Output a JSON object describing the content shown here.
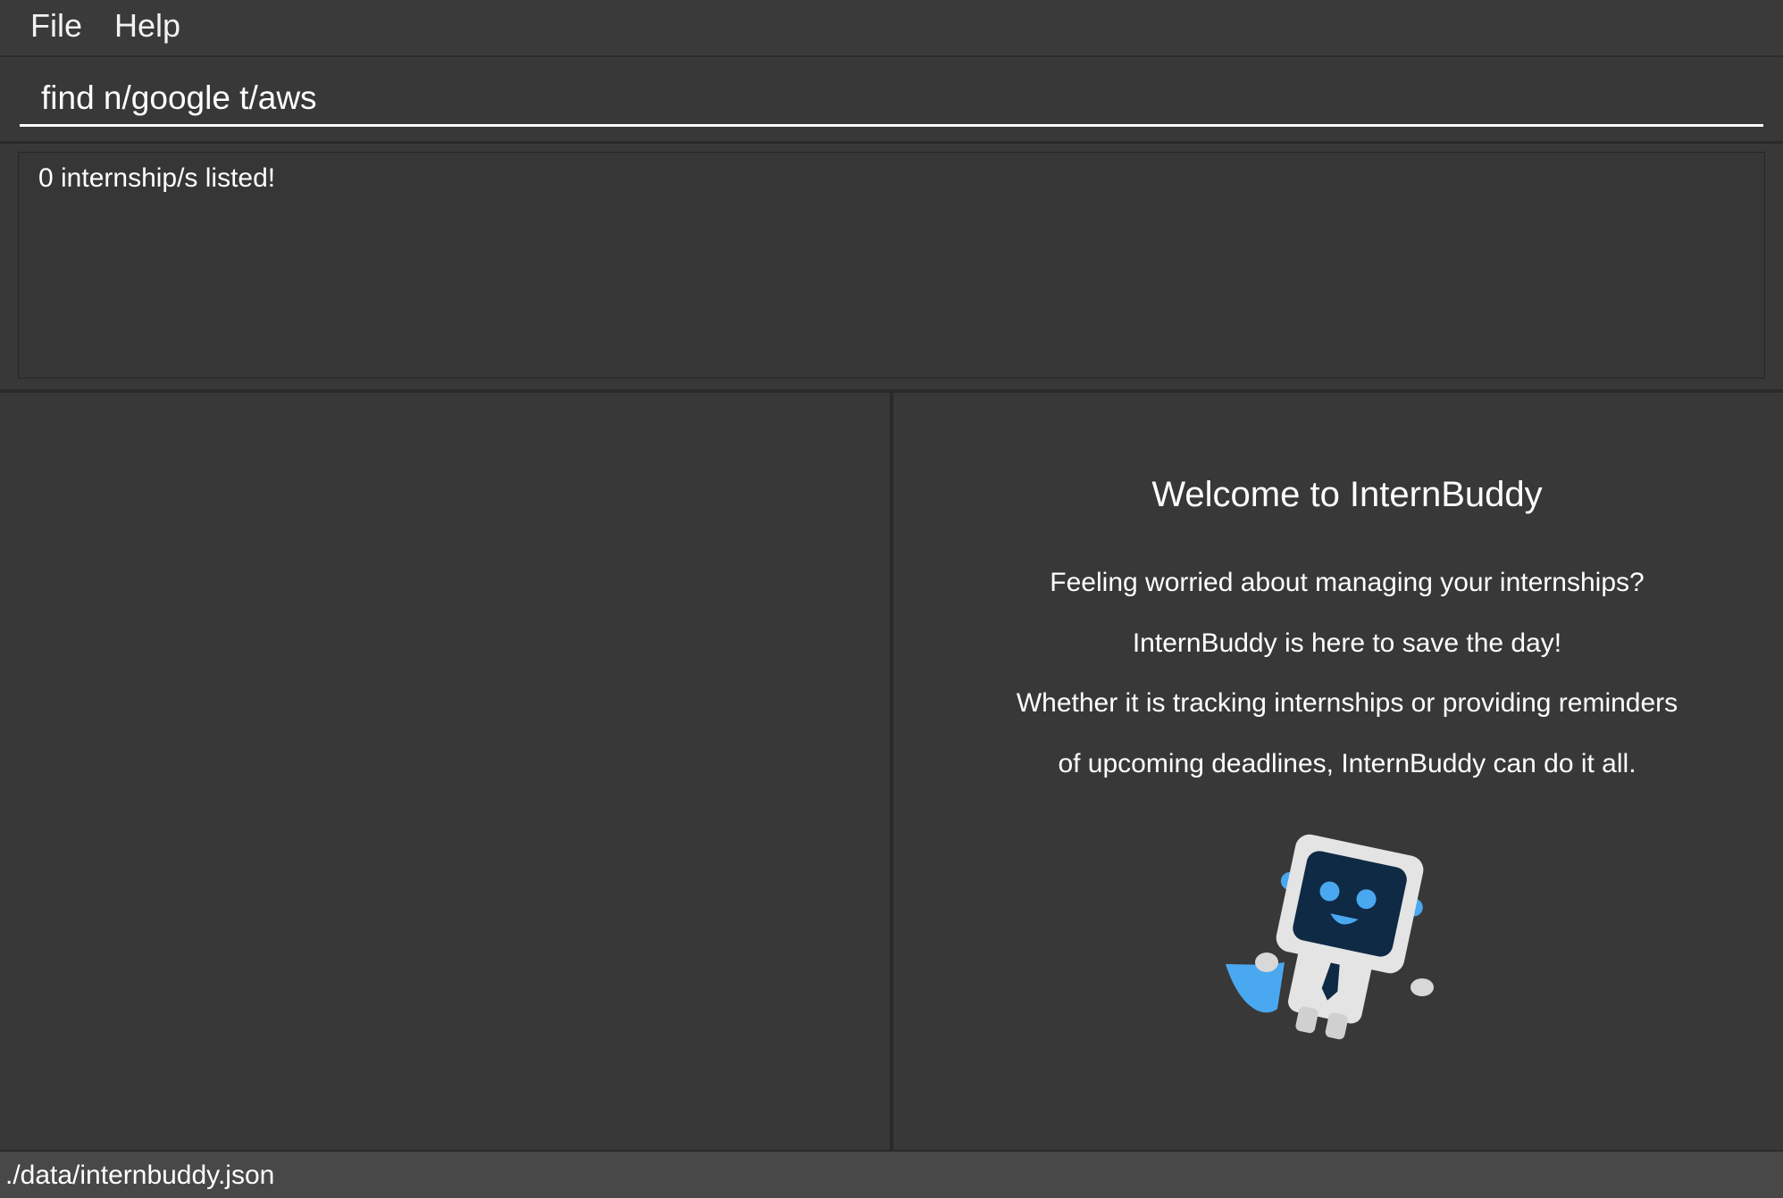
{
  "menu": {
    "file_label": "File",
    "help_label": "Help"
  },
  "command_box": {
    "value": "find n/google t/aws"
  },
  "result_display": {
    "text": "0 internship/s listed!"
  },
  "welcome_panel": {
    "title": "Welcome to InternBuddy",
    "lines": [
      "Feeling worried about managing your internships?",
      "InternBuddy is here to save the day!",
      "Whether it is tracking internships or providing reminders",
      "of upcoming deadlines, InternBuddy can do it all."
    ],
    "mascot_icon": "robot-mascot-icon"
  },
  "status_bar": {
    "file_path": "./data/internbuddy.json"
  },
  "colors": {
    "background": "#383838",
    "mascot_blue": "#4aa8f0",
    "mascot_screen": "#0f2a45",
    "mascot_body": "#e4e4e4"
  }
}
